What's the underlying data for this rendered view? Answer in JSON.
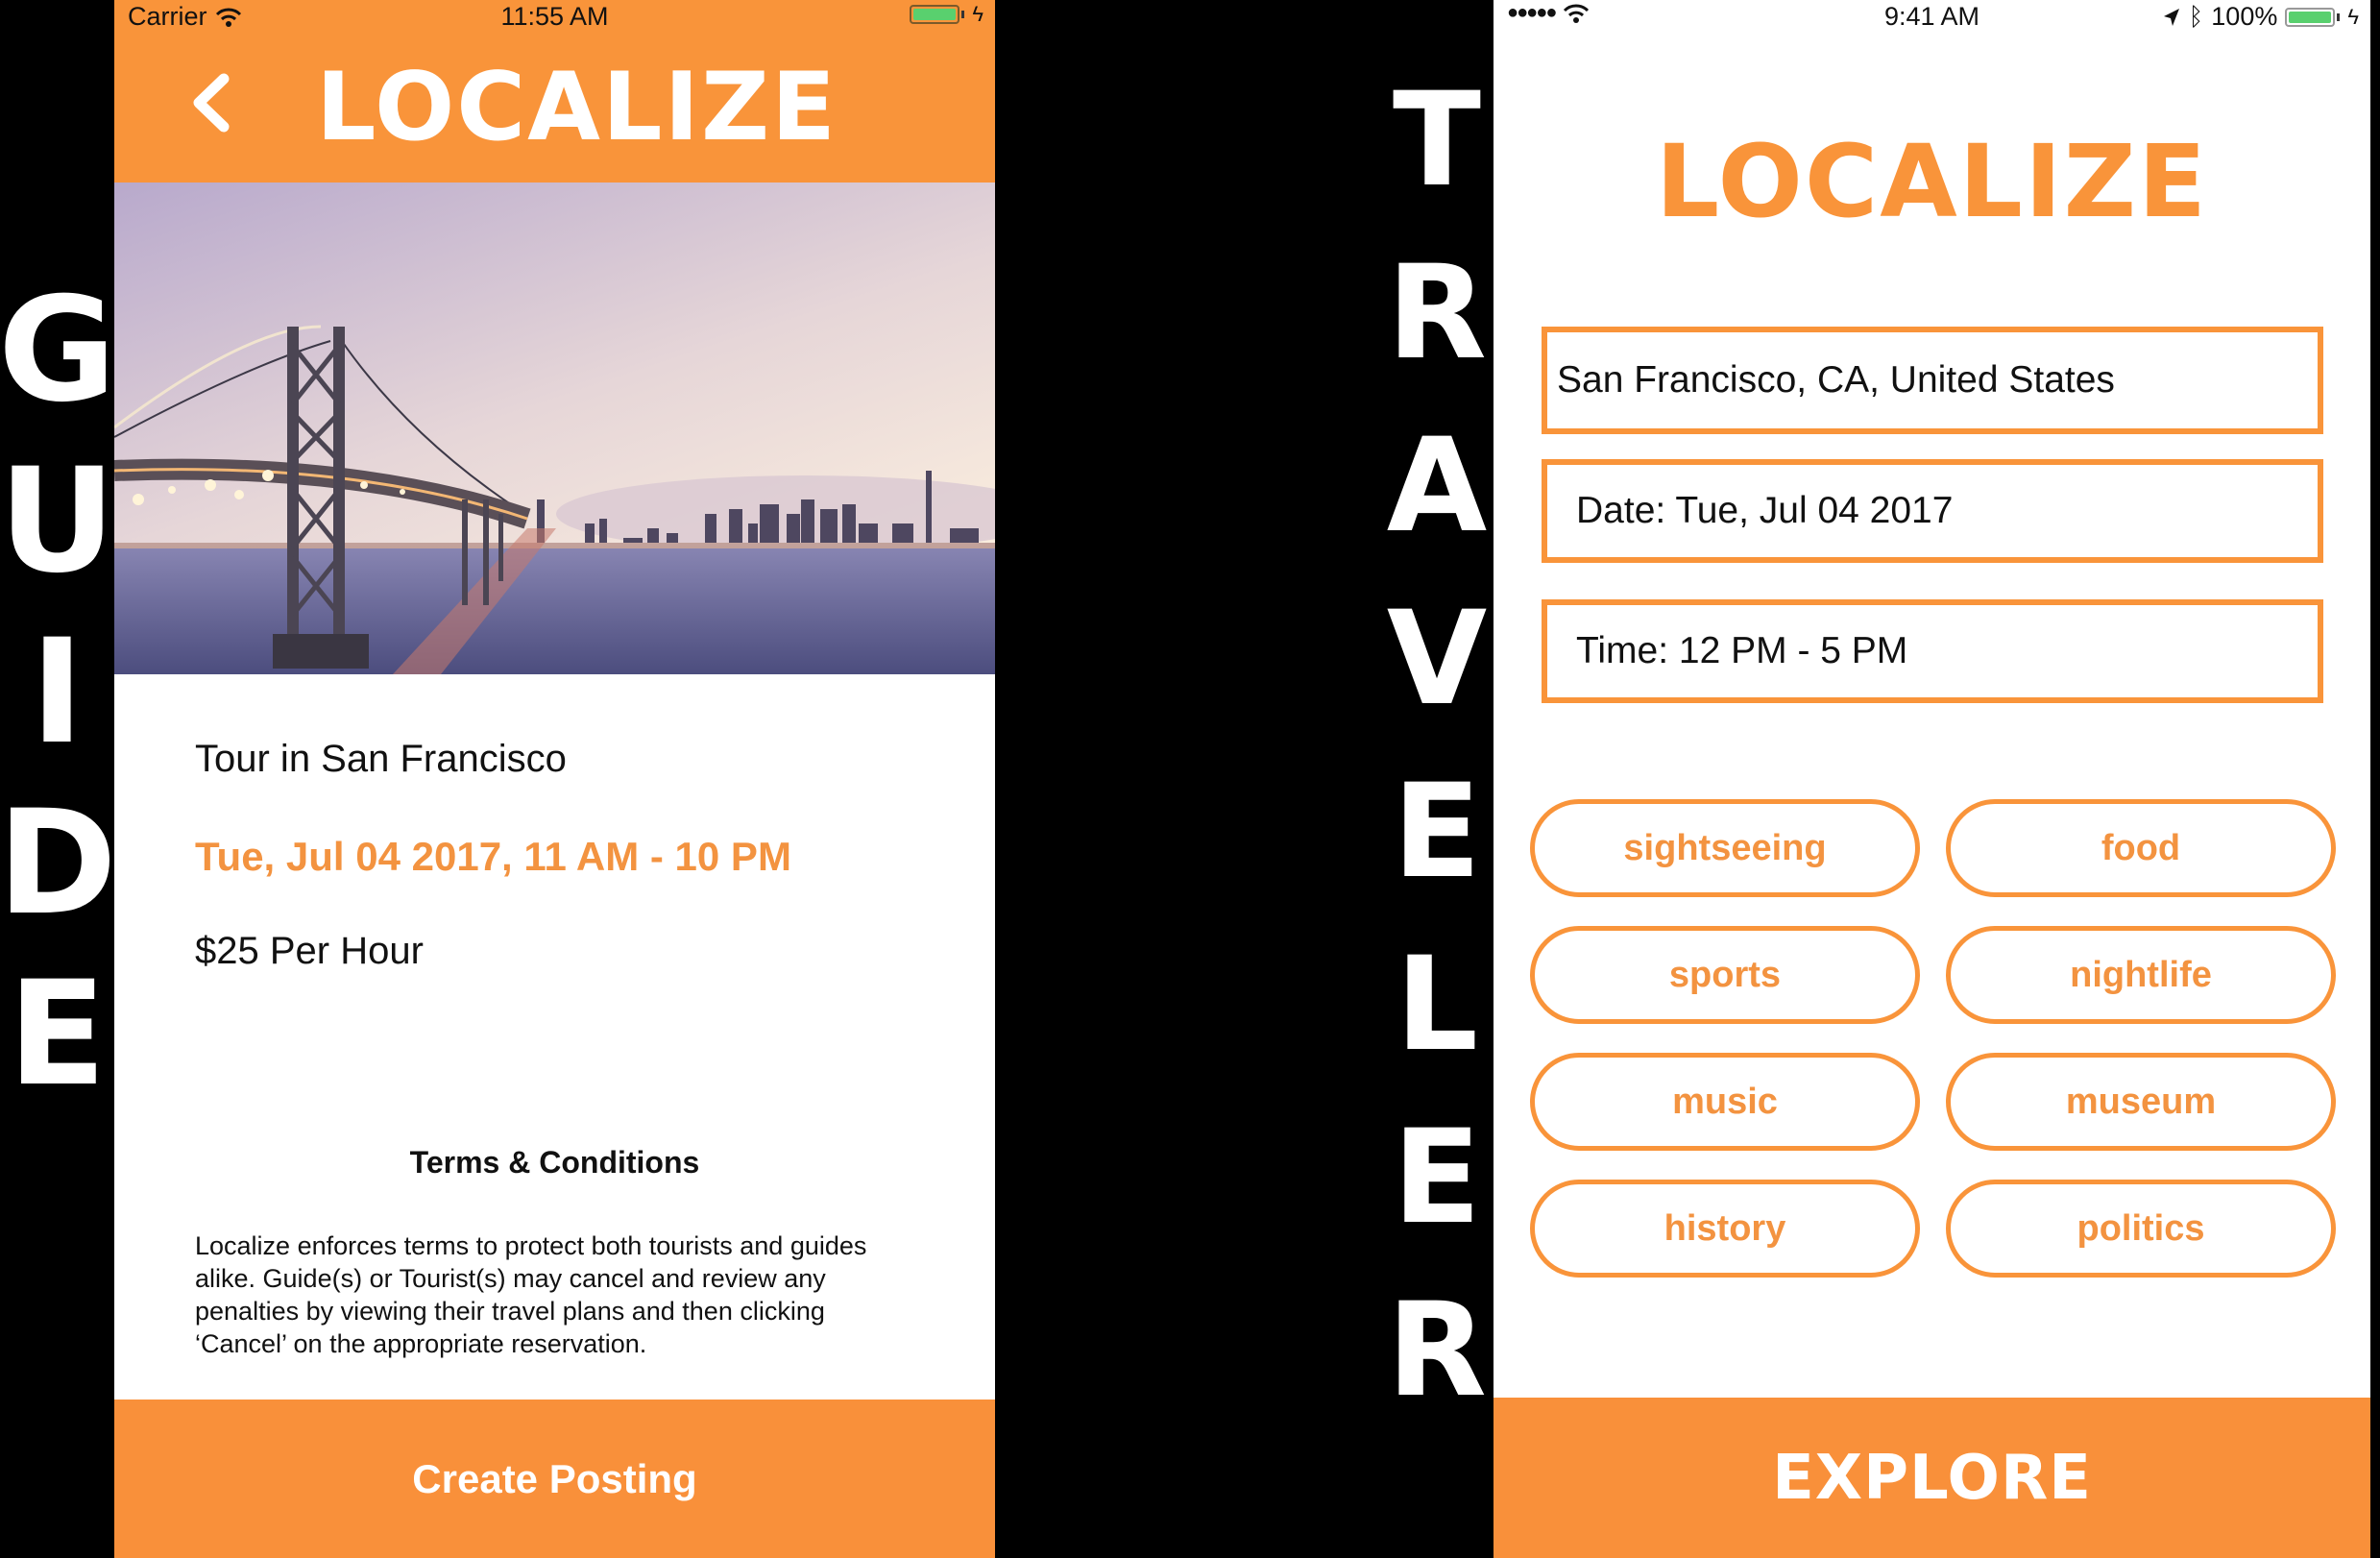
{
  "labels": {
    "left_side": [
      "G",
      "U",
      "I",
      "D",
      "E"
    ],
    "right_side": [
      "T",
      "R",
      "A",
      "V",
      "E",
      "L",
      "E",
      "R"
    ]
  },
  "guide_screen": {
    "status_bar": {
      "carrier": "Carrier",
      "time": "11:55 AM"
    },
    "header": {
      "title": "LOCALIZE",
      "back_icon": "chevron-left-icon"
    },
    "hero_image": {
      "description": "Bay Bridge and San Francisco skyline at dusk"
    },
    "tour": {
      "title": "Tour in San Francisco",
      "datetime": "Tue, Jul 04 2017, 11 AM - 10 PM",
      "price": "$25 Per Hour"
    },
    "terms": {
      "heading": "Terms & Conditions",
      "body": "Localize enforces terms to protect both tourists and guides alike. Guide(s) or Tourist(s) may cancel and review any penalties by viewing their travel plans and then clicking ‘Cancel’ on the appropriate reservation."
    },
    "primary_button": "Create Posting"
  },
  "traveler_screen": {
    "status_bar": {
      "signal": "●●●●●",
      "time": "9:41 AM",
      "battery": "100%"
    },
    "logo": "LOCALIZE",
    "fields": {
      "location": "San Francisco, CA, United States",
      "date": "Date: Tue, Jul 04 2017",
      "time": "Time: 12 PM - 5 PM"
    },
    "interests": [
      "sightseeing",
      "food",
      "sports",
      "nightlife",
      "music",
      "museum",
      "history",
      "politics"
    ],
    "primary_button": "EXPLORE"
  },
  "colors": {
    "accent": "#F9943A",
    "text": "#111111",
    "battery": "#59D06E"
  }
}
